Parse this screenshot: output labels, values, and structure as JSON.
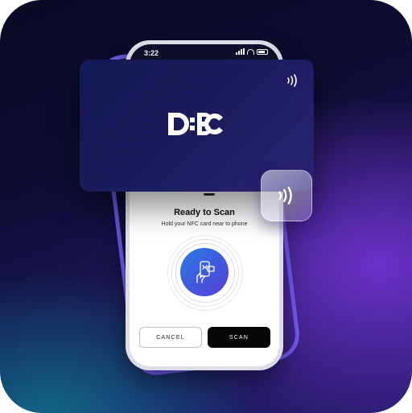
{
  "status_bar": {
    "time": "3:22"
  },
  "card": {
    "logo_text": "DBC",
    "nfc_icon": "nfc-contactless-icon"
  },
  "nfc_tile": {
    "icon": "nfc-contactless-icon"
  },
  "sheet": {
    "title": "Ready to Scan",
    "subtitle": "Hold your NFC card near to phone",
    "illustration_icon": "hand-holding-phone-icon"
  },
  "buttons": {
    "cancel": "CANCEL",
    "scan": "SCAN"
  },
  "colors": {
    "accent_purple": "#6f5bf0",
    "card_navy": "#1a1b5a",
    "scan_gradient_start": "#2c7ae8",
    "scan_gradient_end": "#5a3fd6",
    "scan_button": "#060608"
  }
}
